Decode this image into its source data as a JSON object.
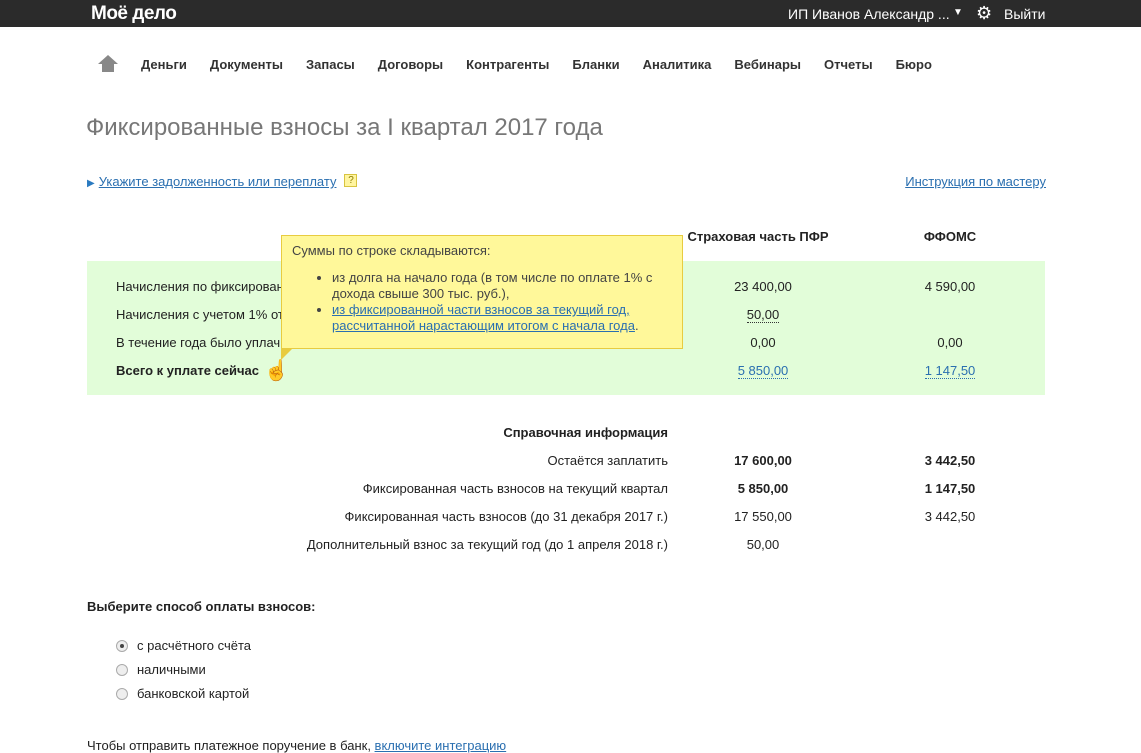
{
  "header": {
    "logo": "Моё дело",
    "user": "ИП Иванов Александр ...",
    "logout": "Выйти"
  },
  "nav": [
    "Деньги",
    "Документы",
    "Запасы",
    "Договоры",
    "Контрагенты",
    "Бланки",
    "Аналитика",
    "Вебинары",
    "Отчеты",
    "Бюро"
  ],
  "title": "Фиксированные взносы за I квартал 2017 года",
  "debt_link": "Укажите задолженность или переплату",
  "help": "?",
  "instruction_link": "Инструкция по мастеру",
  "columns": {
    "pfr": "Страховая часть ПФР",
    "ffoms": "ФФОМС"
  },
  "rows": [
    {
      "label": "Начисления по фиксирован",
      "pfr": "23 400,00",
      "ffoms": "4 590,00"
    },
    {
      "label": "Начисления с учетом 1% от",
      "pfr": "50,00",
      "ffoms": ""
    },
    {
      "label": "В течение года было уплач",
      "pfr": "0,00",
      "ffoms": "0,00"
    },
    {
      "label": "Всего к уплате сейчас",
      "pfr": "5 850,00",
      "ffoms": "1 147,50"
    }
  ],
  "tooltip": {
    "title": "Суммы по строке складываются:",
    "item1": "из долга на начало года (в том числе по оплате 1% с дохода свыше 300 тыс. руб.),",
    "item2": "из фиксированной части взносов за текущий год, рассчитанной нарастающим итогом с начала года",
    "item2_end": "."
  },
  "reference": {
    "title": "Справочная информация",
    "rows": [
      {
        "label": "Остаётся заплатить",
        "pfr": "17 600,00",
        "ffoms": "3 442,50"
      },
      {
        "label": "Фиксированная часть взносов на текущий квартал",
        "pfr": "5 850,00",
        "ffoms": "1 147,50"
      },
      {
        "label": "Фиксированная часть взносов (до 31 декабря 2017 г.)",
        "pfr": "17 550,00",
        "ffoms": "3 442,50"
      },
      {
        "label": "Дополнительный взнос за текущий год (до 1 апреля 2018 г.)",
        "pfr": "50,00",
        "ffoms": ""
      }
    ]
  },
  "payment": {
    "title": "Выберите способ оплаты взносов:",
    "options": [
      "с расчётного счёта",
      "наличными",
      "банковской картой"
    ],
    "selected": 0
  },
  "bottom": {
    "text": "Чтобы отправить платежное поручение в банк, ",
    "link": "включите интеграцию"
  }
}
